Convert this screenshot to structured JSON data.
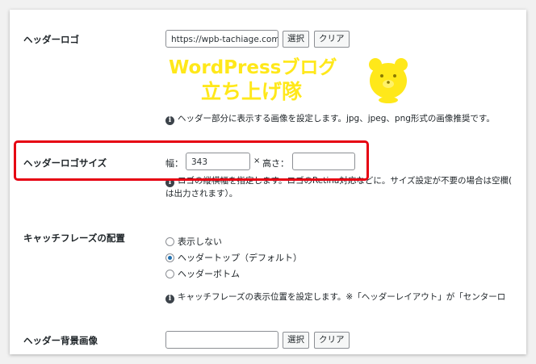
{
  "header_logo": {
    "label": "ヘッダーロゴ",
    "url_value": "https://wpb-tachiage.com",
    "select_label": "選択",
    "clear_label": "クリア",
    "logo_line1": "WordPressブログ",
    "logo_line2": "立ち上げ隊",
    "description": "ヘッダー部分に表示する画像を設定します。jpg、jpeg、png形式の画像推奨です。"
  },
  "logo_size": {
    "label": "ヘッダーロゴサイズ",
    "width_label": "幅：",
    "width_value": "343",
    "times": "×",
    "height_label": "高さ：",
    "height_value": "",
    "description_line1": "ロゴの縦横幅を指定します。ロゴのRetina対応などに。サイズ設定が不要の場合は空欄(",
    "description_line2": "は出力されます）。"
  },
  "catchphrase": {
    "label": "キャッチフレーズの配置",
    "options": [
      {
        "label": "表示しない",
        "checked": false
      },
      {
        "label": "ヘッダートップ（デフォルト）",
        "checked": true
      },
      {
        "label": "ヘッダーボトム",
        "checked": false
      }
    ],
    "description": "キャッチフレーズの表示位置を設定します。※「ヘッダーレイアウト」が「センターロ"
  },
  "bg_image": {
    "label": "ヘッダー背景画像",
    "url_value": "",
    "select_label": "選択",
    "clear_label": "クリア"
  },
  "info_icon_glyph": "i",
  "colors": {
    "highlight": "#e60012",
    "logo_yellow": "#ffe81a",
    "radio_accent": "#2271b1"
  }
}
